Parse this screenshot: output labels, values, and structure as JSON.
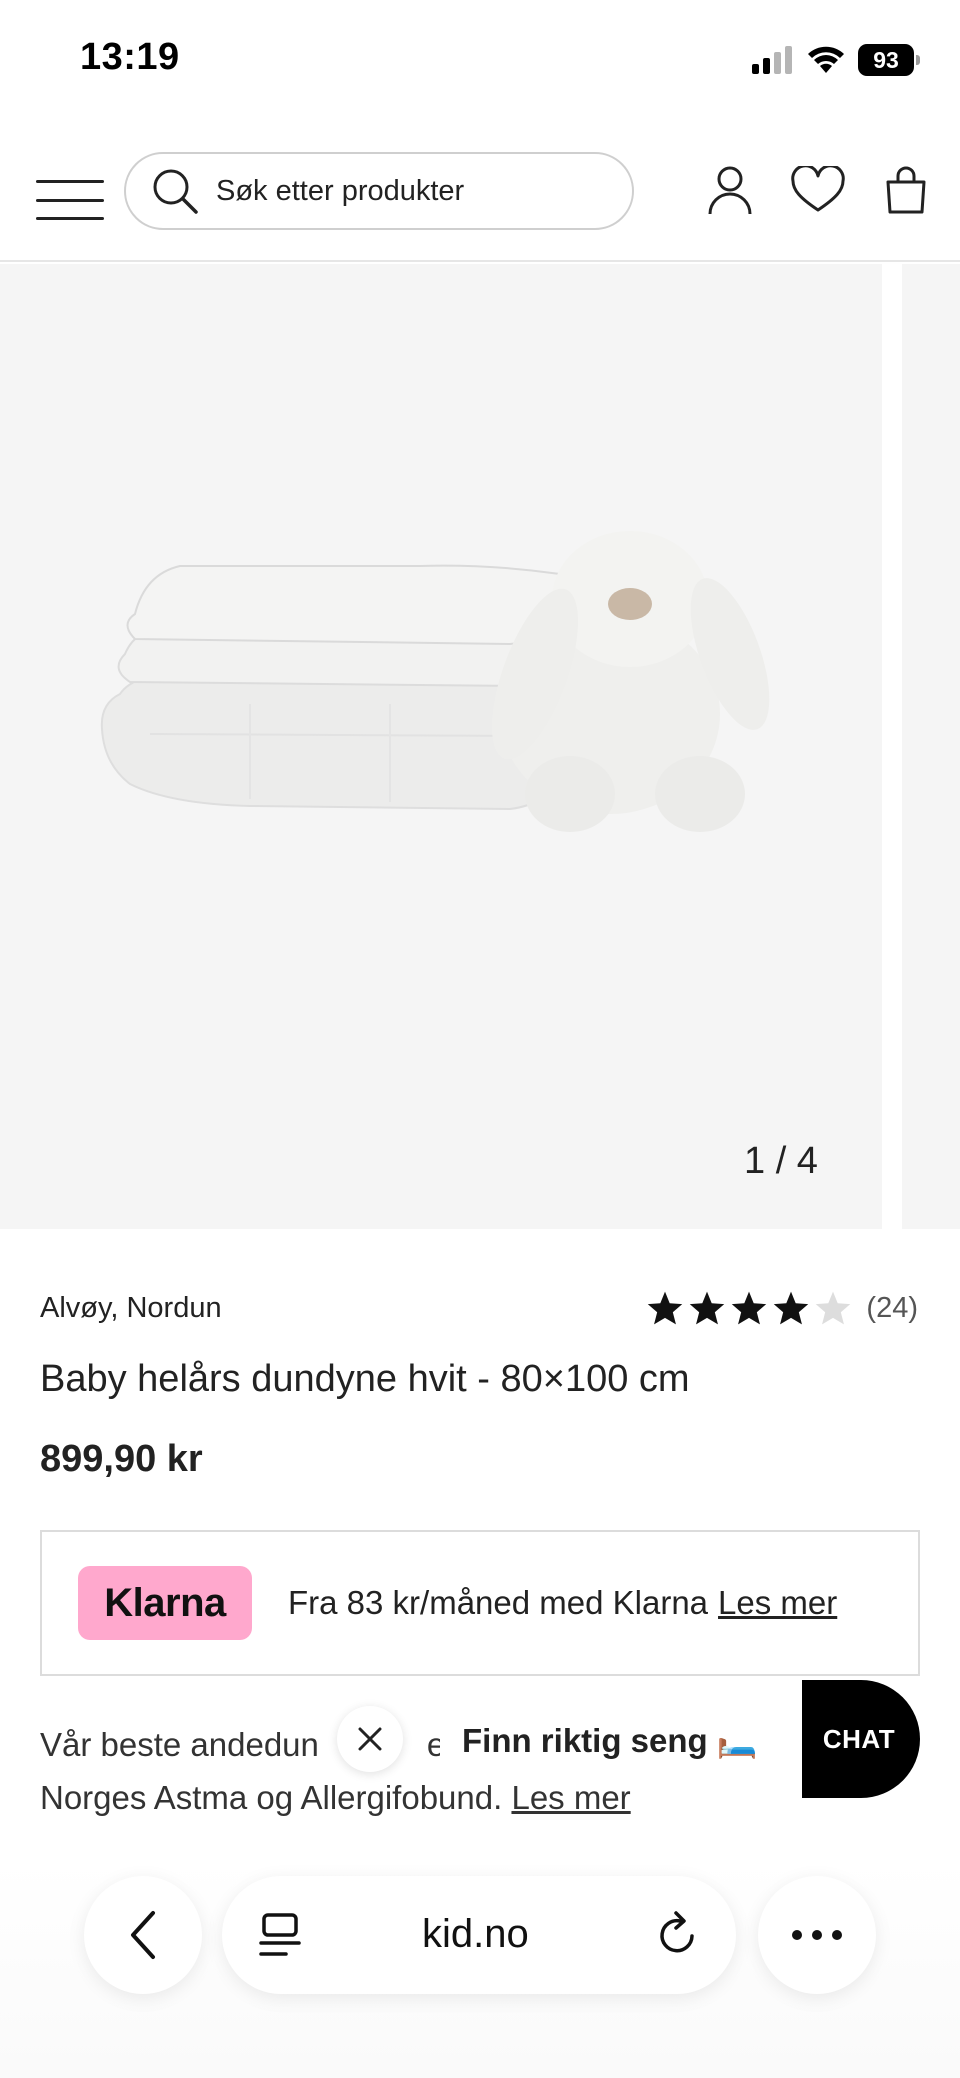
{
  "status_bar": {
    "time": "13:19",
    "battery": "93"
  },
  "header": {
    "search_placeholder": "Søk etter produkter"
  },
  "gallery": {
    "counter": "1 / 4"
  },
  "product": {
    "brand": "Alvøy, Nordun",
    "rating_count": "(24)",
    "rating_value": 4,
    "rating_max": 5,
    "title": "Baby helårs dundyne hvit - 80×100 cm",
    "price": "899,90 kr"
  },
  "klarna": {
    "logo": "Klarna",
    "text": "Fra 83 kr/måned med Klarna",
    "link": "Les mer"
  },
  "description": {
    "line1": "Vår beste andedun",
    "line1_tail": "e",
    "line2": "Norges Astma og Allergifo",
    "line2_tail": "bund.",
    "link": "Les mer"
  },
  "popup": {
    "finn_seng": "Finn riktig seng 🛏️"
  },
  "chat": {
    "label": "CHAT"
  },
  "browser": {
    "url": "kid.no"
  },
  "colors": {
    "klarna_pink": "#ffa8cd",
    "star_filled": "#111111",
    "star_empty": "#dddddd"
  }
}
